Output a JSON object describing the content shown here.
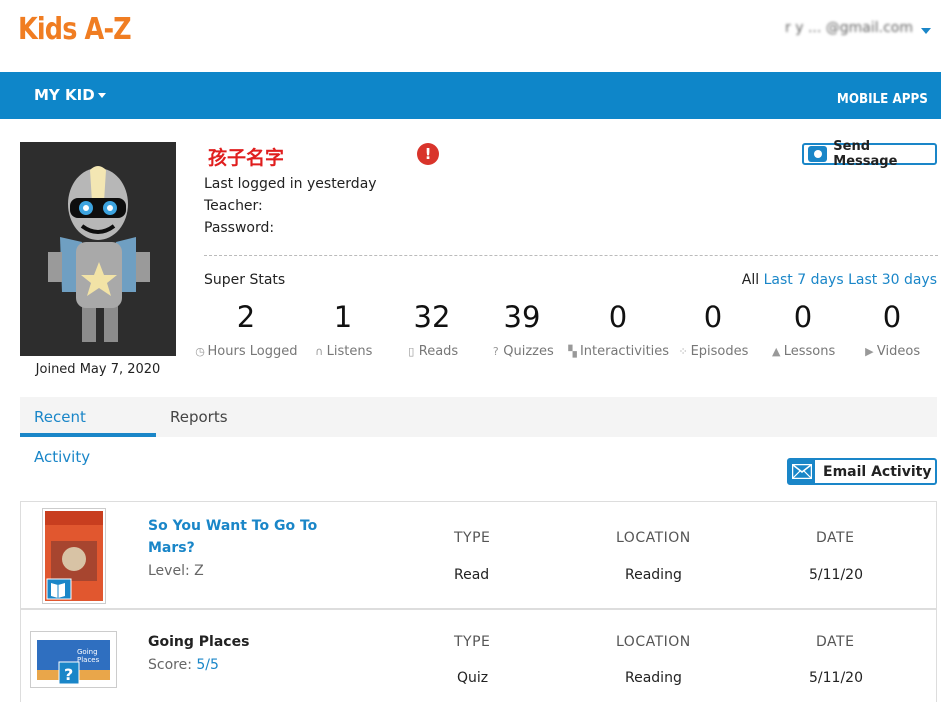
{
  "brand": {
    "logo": "Kids A-Z",
    "accent": "#f07d22",
    "primary": "#0e86c9"
  },
  "account": {
    "email": "r y ... @gmail.com"
  },
  "nav": {
    "my_kid": "MY KID",
    "mobile_apps": "MOBILE APPS"
  },
  "student": {
    "name": "孩子名字",
    "last_logged": "Last logged in yesterday",
    "teacher_label": "Teacher:",
    "password_label": "Password:",
    "joined": "Joined May 7, 2020",
    "send_message": "Send Message"
  },
  "stats": {
    "heading": "Super Stats",
    "period_all": "All",
    "period_7": "Last 7 days",
    "period_30": "Last 30 days",
    "items": [
      {
        "value": "2",
        "label": "Hours Logged",
        "icon": "clock-icon"
      },
      {
        "value": "1",
        "label": "Listens",
        "icon": "headphones-icon"
      },
      {
        "value": "32",
        "label": "Reads",
        "icon": "book-icon"
      },
      {
        "value": "39",
        "label": "Quizzes",
        "icon": "question-icon"
      },
      {
        "value": "0",
        "label": "Interactivities",
        "icon": "puzzle-icon"
      },
      {
        "value": "0",
        "label": "Episodes",
        "icon": "episode-icon"
      },
      {
        "value": "0",
        "label": "Lessons",
        "icon": "flask-icon"
      },
      {
        "value": "0",
        "label": "Videos",
        "icon": "play-icon"
      }
    ]
  },
  "tabs": {
    "recent": "Recent Activity",
    "reports": "Reports"
  },
  "email_activity": "Email Activity",
  "columns": {
    "type": "TYPE",
    "location": "LOCATION",
    "date": "DATE"
  },
  "activities": [
    {
      "title": "So You Want To Go To Mars?",
      "sub_label": "Level:",
      "sub_value": "Z",
      "type": "Read",
      "location": "Reading",
      "date": "5/11/20",
      "thumb_text": "So You Want to Go to Mars?"
    },
    {
      "title": "Going Places",
      "sub_label": "Score:",
      "sub_value": "5/5",
      "type": "Quiz",
      "location": "Reading",
      "date": "5/11/20",
      "thumb_text": "Going Places"
    }
  ]
}
